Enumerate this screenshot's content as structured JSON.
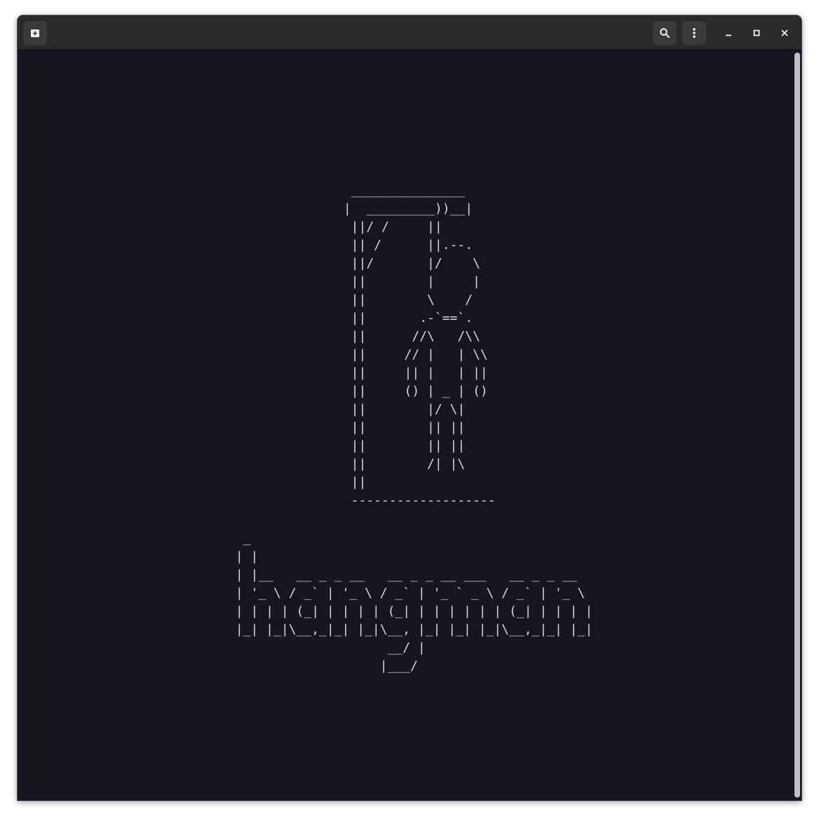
{
  "window": {
    "title": "",
    "background": "#161622",
    "headerbar_color": "#2a2a2c"
  },
  "headerbar": {
    "new_tab_icon": "new-tab-icon",
    "search_icon": "search-icon",
    "menu_icon": "kebab-menu-icon",
    "minimize_icon": "minimize-icon",
    "maximize_icon": "maximize-icon",
    "close_icon": "close-icon"
  },
  "terminal": {
    "text_color": "#d6d6dc",
    "gallows": "  _______________\n |  _________))__|\n  ||/ /     ||\n  || /      ||.--.\n  ||/       |/    \\\n  ||        |     |\n  ||        \\    /\n  ||       .-`==`.\n  ||      //\\   /\\\\\n  ||     // |   | \\\\\n  ||     || |   | ||\n  ||     () | _ | ()\n  ||        |/ \\|\n  ||        || ||\n  ||        || ||\n  ||        /| |\\\n  ||\n  -------------------",
    "title": "  _\n | |\n | |__   __ _ _ __   __ _ _ __ ___   __ _ _ __\n | '_ \\ / _` | '_ \\ / _` | '_ ` _ \\ / _` | '_ \\\n | | | | (_| | | | | (_| | | | | | | (_| | | | |\n |_| |_|\\__,_|_| |_|\\__, |_| |_| |_|\\__,_|_| |_|\n                     __/ |\n                    |___/"
  }
}
